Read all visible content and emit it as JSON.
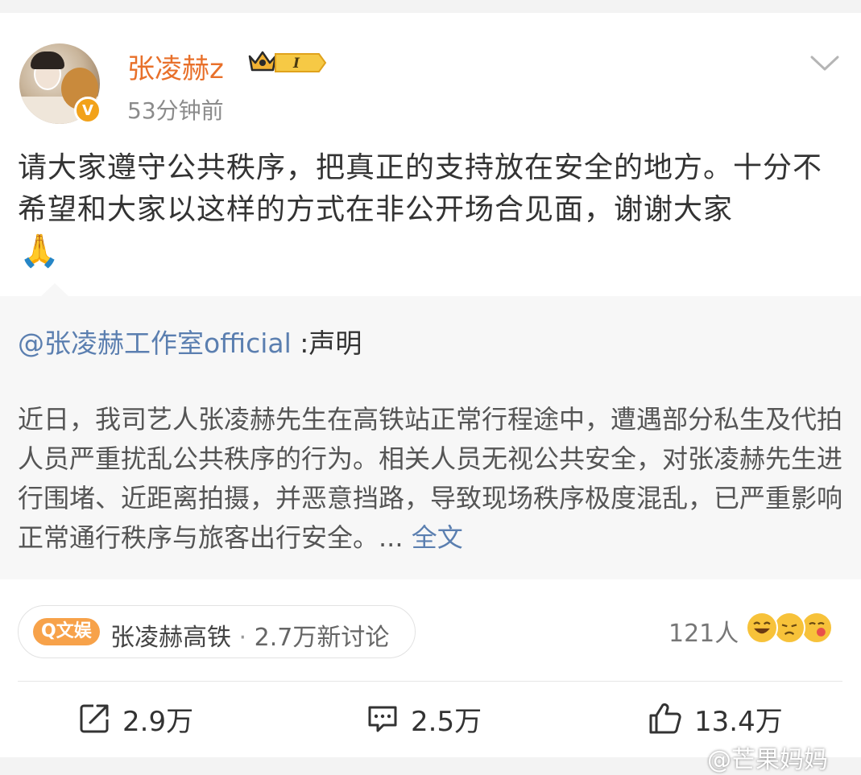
{
  "post": {
    "username": "张凌赫z",
    "level_badge": "I",
    "verified_mark": "V",
    "timestamp": "53分钟前",
    "text": "请大家遵守公共秩序，把真正的支持放在安全的地方。十分不希望和大家以这样的方式在非公开场合见面，谢谢大家",
    "emoji": "🙏"
  },
  "repost": {
    "mention": "@张凌赫工作室official",
    "suffix": " :声明",
    "body": "近日，我司艺人张凌赫先生在高铁站正常行程途中，遭遇部分私生及代拍人员严重扰乱公共秩序的行为。相关人员无视公共安全，对张凌赫先生进行围堵、近距离拍摄，并恶意挡路，导致现场秩序极度混乱，已严重影响正常通行秩序与旅客出行安全。... ",
    "full_text_link": "全文"
  },
  "topic": {
    "badge": "Q文娱",
    "name": "张凌赫高铁",
    "separator": "·",
    "discussion_count": "2.7万新讨论"
  },
  "reactions": {
    "count": "121人",
    "face_color": "#f7c23a"
  },
  "actions": {
    "repost_count": "2.9万",
    "comment_count": "2.5万",
    "like_count": "13.4万"
  },
  "watermark": "@芒果妈妈",
  "colors": {
    "username": "#e8702a",
    "link": "#5b7fb0",
    "topic_badge": "#f7a24a",
    "verified": "#f2a21a"
  }
}
